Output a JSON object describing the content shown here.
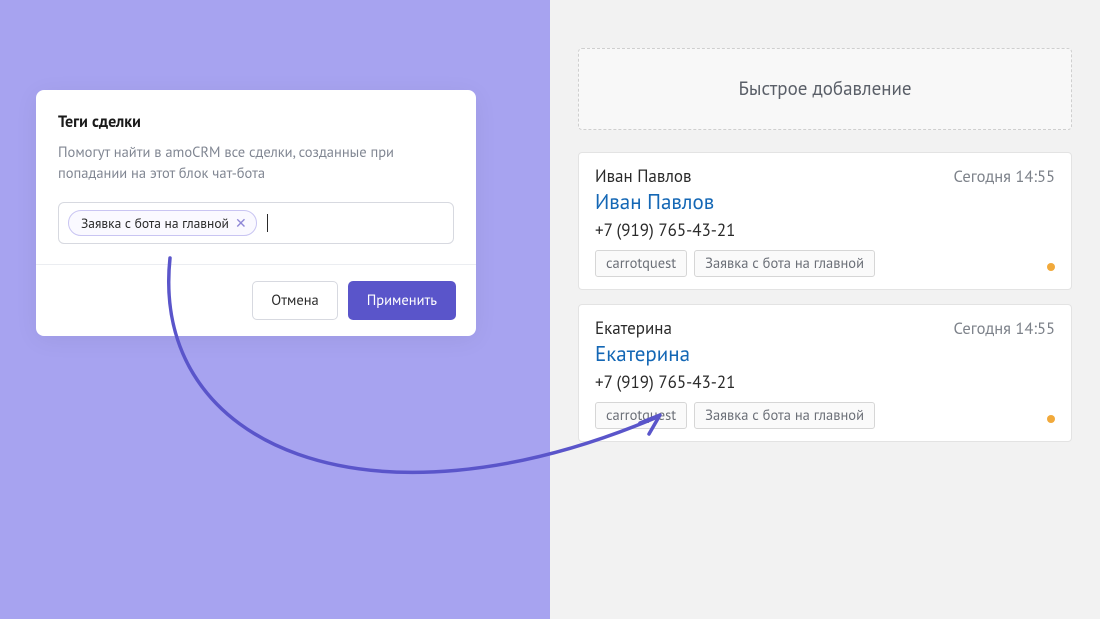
{
  "left": {
    "title": "Теги сделки",
    "description": "Помогут найти в amoCRM все сделки, созданные при попадании на этот блок чат-бота",
    "tag_chip": "Заявка с бота на главной",
    "cancel_label": "Отмена",
    "apply_label": "Применить"
  },
  "right": {
    "quick_add": "Быстрое добавление",
    "leads": [
      {
        "contact": "Иван Павлов",
        "title": "Иван Павлов",
        "time": "Сегодня 14:55",
        "phone": "+7 (919) 765-43-21",
        "tags": [
          "carrotquest",
          "Заявка с бота на главной"
        ]
      },
      {
        "contact": "Екатерина",
        "title": "Екатерина",
        "time": "Сегодня 14:55",
        "phone": "+7 (919) 765-43-21",
        "tags": [
          "carrotquest",
          "Заявка с бота на главной"
        ]
      }
    ]
  }
}
